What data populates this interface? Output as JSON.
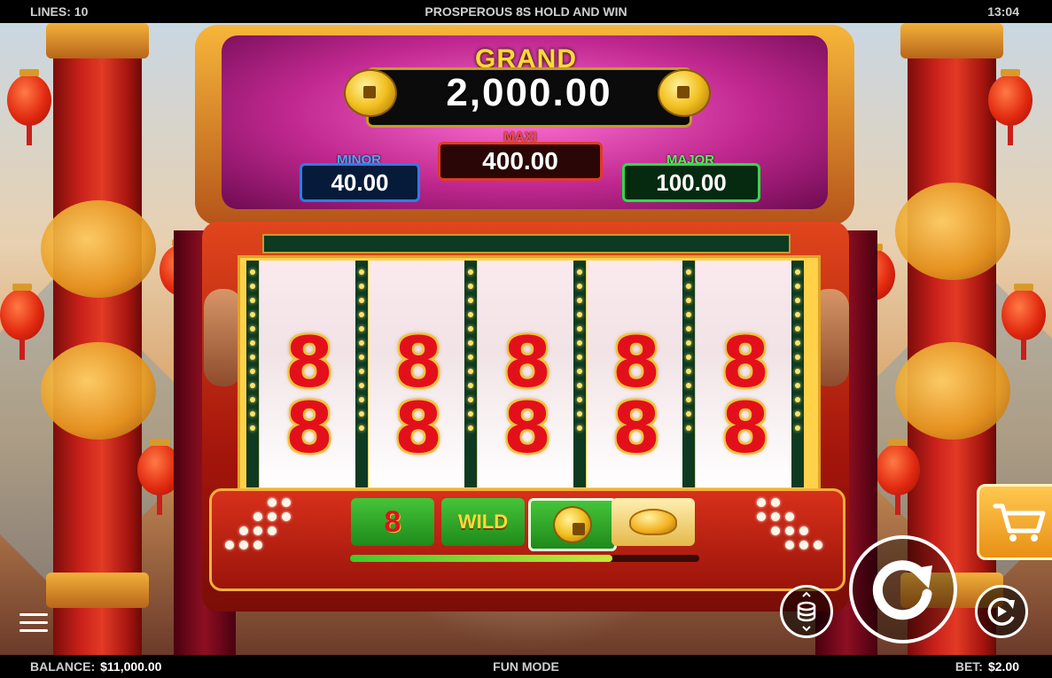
{
  "topbar": {
    "lines": "LINES: 10",
    "title": "PROSPEROUS 8S HOLD AND WIN",
    "time": "13:04"
  },
  "jackpots": {
    "grand_label": "GRAND",
    "grand_value": "2,000.00",
    "maxi_label": "MAXI",
    "maxi_value": "400.00",
    "minor_label": "MINOR",
    "minor_value": "40.00",
    "major_label": "MAJOR",
    "major_value": "100.00"
  },
  "reels": {
    "symbol": "8",
    "columns": 5,
    "rows": 2
  },
  "features": {
    "eight_symbol": "8",
    "wild_label": "WILD",
    "coin_icon": "coin-icon",
    "gold_icon": "gold-ingot-icon",
    "progress_fraction": 0.75
  },
  "colors": {
    "accent_gold": "#f2b13a",
    "reel_red": "#e3101c",
    "minor_blue": "#2f7be8",
    "maxi_red": "#e23a25",
    "major_green": "#31d94a"
  },
  "bottombar": {
    "balance_label": "BALANCE:",
    "balance_value": "$11,000.00",
    "mode": "FUN MODE",
    "bet_label": "BET:",
    "bet_value": "$2.00"
  }
}
